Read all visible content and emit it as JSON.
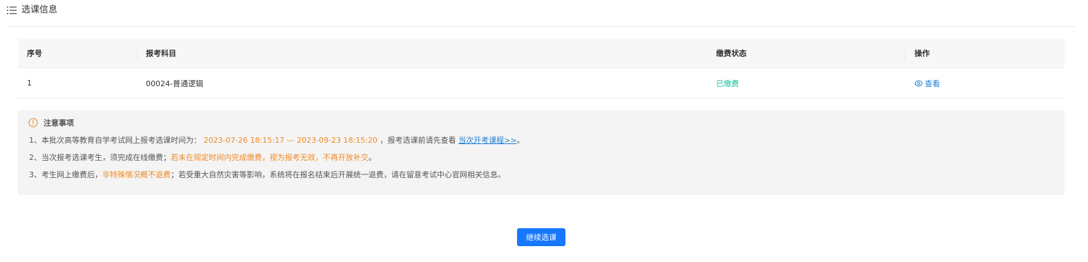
{
  "section": {
    "title": "选课信息",
    "icon": "list-icon"
  },
  "table": {
    "headers": [
      "序号",
      "报考科目",
      "缴费状态",
      "操作"
    ],
    "rows": [
      {
        "index": "1",
        "subject": "00024-普通逻辑",
        "status": "已缴费",
        "action": "查看"
      }
    ],
    "status_color": "#19be9b",
    "action_icon": "eye-icon"
  },
  "notice": {
    "title": "注意事项",
    "icon": "warning-circle-icon",
    "line1_prefix": "1、本批次高等教育自学考试网上报考选课时间为：",
    "line1_time": "2023-07-26 18:15:17 — 2023-09-23 18:15:20",
    "line1_middle": "，报考选课前请先查看",
    "line1_link": "当次开考课程>>",
    "line1_suffix": "。",
    "line2_prefix": "2、当次报考选课考生，须完成在线缴费；",
    "line2_highlight": "若未在规定时间内完成缴费，视为报考无效，不再开放补交",
    "line2_suffix": "。",
    "line3_prefix": "3、考生网上缴费后，",
    "line3_highlight": "非特殊情况概不退费",
    "line3_suffix": "；若受重大自然灾害等影响，系统将在报名结束后开展统一退费，请在留意考试中心官网相关信息。",
    "highlight_color": "#f08a24",
    "link_color": "#1c7ed6"
  },
  "actions": {
    "continue_label": "继续选课",
    "button_color": "#1677ff"
  }
}
